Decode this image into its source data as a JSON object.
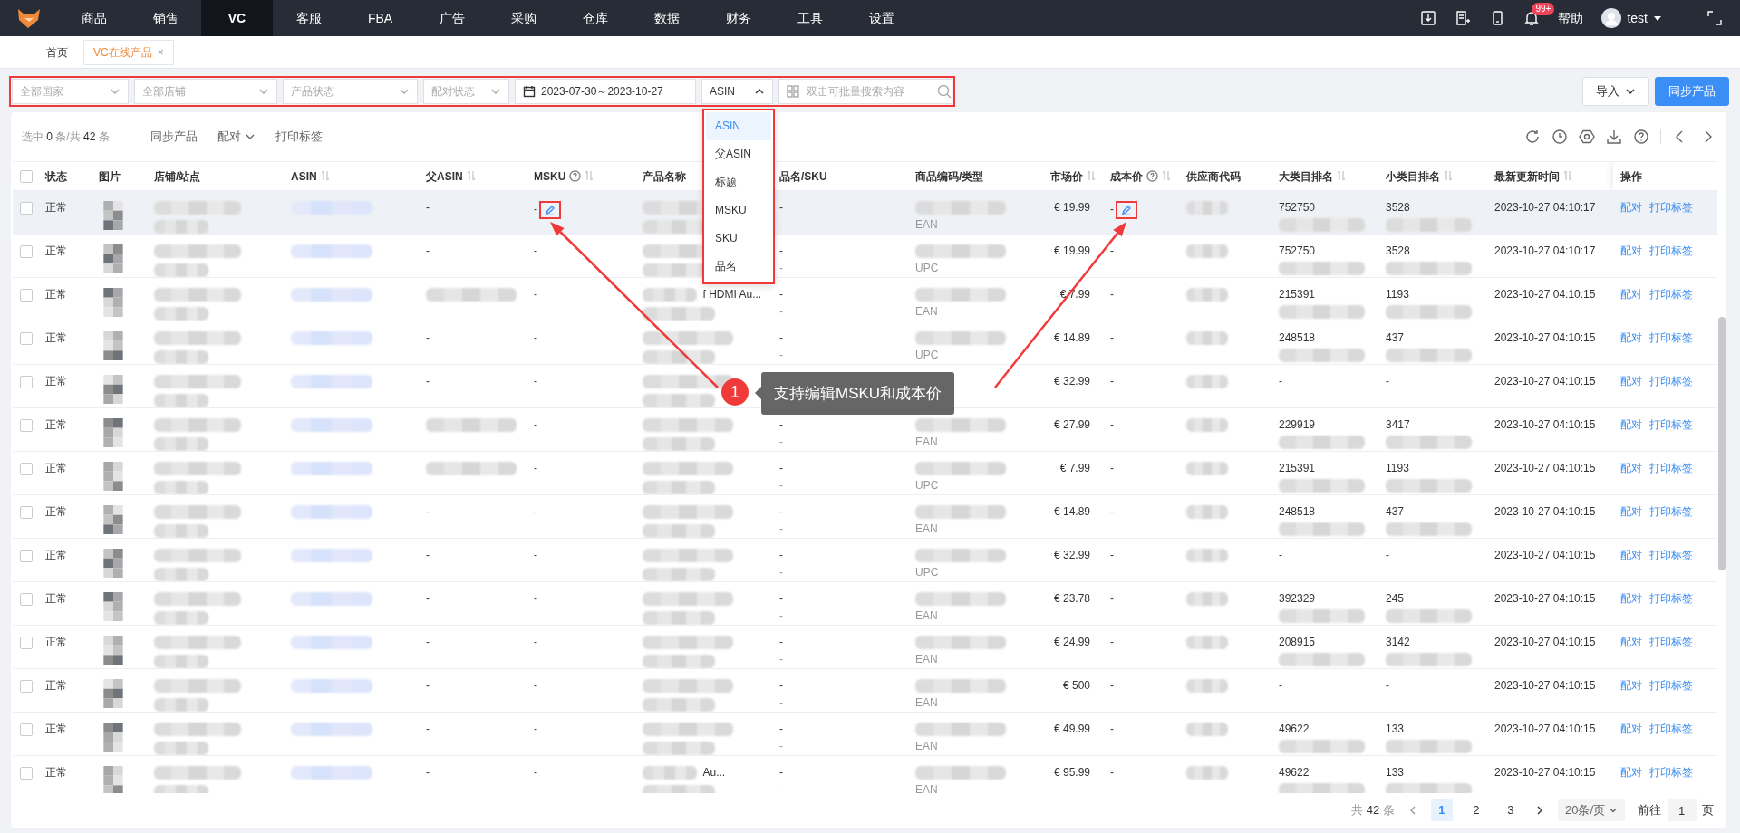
{
  "nav": {
    "items": [
      {
        "label": "商品",
        "selected": false
      },
      {
        "label": "销售",
        "selected": false
      },
      {
        "label": "VC",
        "selected": true
      },
      {
        "label": "客服",
        "selected": false
      },
      {
        "label": "FBA",
        "selected": false
      },
      {
        "label": "广告",
        "selected": false
      },
      {
        "label": "采购",
        "selected": false
      },
      {
        "label": "仓库",
        "selected": false
      },
      {
        "label": "数据",
        "selected": false
      },
      {
        "label": "财务",
        "selected": false
      },
      {
        "label": "工具",
        "selected": false
      },
      {
        "label": "设置",
        "selected": false
      }
    ],
    "notification_badge": "99+",
    "help": "帮助",
    "user": "test"
  },
  "tabs": [
    {
      "label": "首页",
      "selected": false
    },
    {
      "label": "VC在线产品",
      "selected": true,
      "close": "×"
    }
  ],
  "filters": [
    {
      "kind": "select",
      "placeholder": "全部国家"
    },
    {
      "kind": "select",
      "placeholder": "全部店铺"
    },
    {
      "kind": "select",
      "placeholder": "产品状态"
    },
    {
      "kind": "select",
      "placeholder": "配对状态"
    },
    {
      "kind": "date",
      "value": "2023-07-30～2023-10-27"
    },
    {
      "kind": "type_select",
      "value": "ASIN",
      "expanded": true,
      "options": [
        {
          "label": "ASIN",
          "selected": true
        },
        {
          "label": "父ASIN",
          "selected": false
        },
        {
          "label": "标题",
          "selected": false
        },
        {
          "label": "MSKU",
          "selected": false
        },
        {
          "label": "SKU",
          "selected": false
        },
        {
          "label": "品名",
          "selected": false
        }
      ]
    },
    {
      "kind": "search",
      "placeholder": "双击可批量搜索内容"
    }
  ],
  "header_buttons": [
    {
      "label": "导入",
      "kind": "dropdown"
    },
    {
      "label": "同步产品",
      "kind": "primary"
    }
  ],
  "toolbar": {
    "selection": "选中 **0** 条/共 **42** 条",
    "actions": [
      {
        "label": "同步产品",
        "dropdown": false
      },
      {
        "label": "配对",
        "dropdown": true
      },
      {
        "label": "打印标签",
        "dropdown": false
      }
    ]
  },
  "table": {
    "select_all_checked": false,
    "columns": [
      {
        "label": "状态",
        "help": false,
        "sortable": false
      },
      {
        "label": "图片",
        "help": false,
        "sortable": false
      },
      {
        "label": "店铺/站点",
        "help": false,
        "sortable": false
      },
      {
        "label": "ASIN",
        "help": false,
        "sortable": true
      },
      {
        "label": "父ASIN",
        "help": false,
        "sortable": true
      },
      {
        "label": "MSKU",
        "help": true,
        "sortable": true
      },
      {
        "label": "产品名称",
        "help": false,
        "sortable": false
      },
      {
        "label": "品名/SKU",
        "help": false,
        "sortable": false
      },
      {
        "label": "商品编码/类型",
        "help": false,
        "sortable": false
      },
      {
        "label": "市场价",
        "help": false,
        "sortable": true
      },
      {
        "label": "成本价",
        "help": true,
        "sortable": true
      },
      {
        "label": "供应商代码",
        "help": false,
        "sortable": false
      },
      {
        "label": "大类目排名",
        "help": false,
        "sortable": true
      },
      {
        "label": "小类目排名",
        "help": false,
        "sortable": true
      },
      {
        "label": "最新更新时间",
        "help": false,
        "sortable": true
      },
      {
        "label": "操作",
        "help": false,
        "sortable": false
      }
    ],
    "rows": [
      {
        "checked": false,
        "highlighted": true,
        "status": "正常",
        "parent_asin": "-",
        "msku": "-",
        "msku_edit": true,
        "name_sku": [
          "-",
          "-"
        ],
        "code_type": "EAN",
        "market_price": "€ 19.99",
        "cost": "-",
        "cost_edit": true,
        "major_rank": "752750",
        "minor_rank": "3528",
        "updated": "2023-10-27 04:10:17",
        "actions": [
          "配对",
          "打印标签"
        ]
      },
      {
        "checked": false,
        "highlighted": false,
        "status": "正常",
        "parent_asin": "-",
        "msku": "-",
        "msku_edit": false,
        "name_sku": [
          "-",
          "-"
        ],
        "code_type": "UPC",
        "market_price": "€ 19.99",
        "cost": "-",
        "cost_edit": false,
        "major_rank": "752750",
        "minor_rank": "3528",
        "updated": "2023-10-27 04:10:17",
        "actions": [
          "配对",
          "打印标签"
        ]
      },
      {
        "checked": false,
        "highlighted": false,
        "status": "正常",
        "msku": "-",
        "msku_edit": false,
        "product_text": "f HDMI Au...",
        "name_sku": [
          "-",
          "-"
        ],
        "code_type": "EAN",
        "market_price": "€ 7.99",
        "cost": "-",
        "cost_edit": false,
        "major_rank": "215391",
        "minor_rank": "1193",
        "updated": "2023-10-27 04:10:15",
        "actions": [
          "配对",
          "打印标签"
        ]
      },
      {
        "checked": false,
        "highlighted": false,
        "status": "正常",
        "parent_asin": "-",
        "msku": "-",
        "msku_edit": false,
        "name_sku": [
          "-",
          "-"
        ],
        "code_type": "UPC",
        "market_price": "€ 14.89",
        "cost": "-",
        "cost_edit": false,
        "major_rank": "248518",
        "minor_rank": "437",
        "updated": "2023-10-27 04:10:15",
        "actions": [
          "配对",
          "打印标签"
        ]
      },
      {
        "checked": false,
        "highlighted": false,
        "status": "正常",
        "parent_asin": "-",
        "msku": "-",
        "msku_edit": false,
        "market_price": "€ 32.99",
        "cost": "-",
        "cost_edit": false,
        "major_rank": "-",
        "minor_rank": "-",
        "updated": "2023-10-27 04:10:15",
        "actions": [
          "配对",
          "打印标签"
        ]
      },
      {
        "checked": false,
        "highlighted": false,
        "status": "正常",
        "msku": "-",
        "msku_edit": false,
        "name_sku": [
          "-",
          "-"
        ],
        "code_type": "EAN",
        "market_price": "€ 27.99",
        "cost": "-",
        "cost_edit": false,
        "major_rank": "229919",
        "minor_rank": "3417",
        "updated": "2023-10-27 04:10:15",
        "actions": [
          "配对",
          "打印标签"
        ]
      },
      {
        "checked": false,
        "highlighted": false,
        "status": "正常",
        "msku": "-",
        "msku_edit": false,
        "name_sku": [
          "-",
          "-"
        ],
        "code_type": "UPC",
        "market_price": "€ 7.99",
        "cost": "-",
        "cost_edit": false,
        "major_rank": "215391",
        "minor_rank": "1193",
        "updated": "2023-10-27 04:10:15",
        "actions": [
          "配对",
          "打印标签"
        ]
      },
      {
        "checked": false,
        "highlighted": false,
        "status": "正常",
        "parent_asin": "-",
        "msku": "-",
        "msku_edit": false,
        "name_sku": [
          "-",
          "-"
        ],
        "code_type": "EAN",
        "market_price": "€ 14.89",
        "cost": "-",
        "cost_edit": false,
        "major_rank": "248518",
        "minor_rank": "437",
        "updated": "2023-10-27 04:10:15",
        "actions": [
          "配对",
          "打印标签"
        ]
      },
      {
        "checked": false,
        "highlighted": false,
        "status": "正常",
        "parent_asin": "-",
        "msku": "-",
        "msku_edit": false,
        "name_sku": [
          "-",
          "-"
        ],
        "code_type": "UPC",
        "market_price": "€ 32.99",
        "cost": "-",
        "cost_edit": false,
        "major_rank": "-",
        "minor_rank": "-",
        "updated": "2023-10-27 04:10:15",
        "actions": [
          "配对",
          "打印标签"
        ]
      },
      {
        "checked": false,
        "highlighted": false,
        "status": "正常",
        "parent_asin": "-",
        "msku": "-",
        "msku_edit": false,
        "name_sku": [
          "-",
          "-"
        ],
        "code_type": "EAN",
        "market_price": "€ 23.78",
        "cost": "-",
        "cost_edit": false,
        "major_rank": "392329",
        "minor_rank": "245",
        "updated": "2023-10-27 04:10:15",
        "actions": [
          "配对",
          "打印标签"
        ]
      },
      {
        "checked": false,
        "highlighted": false,
        "status": "正常",
        "parent_asin": "-",
        "msku": "-",
        "msku_edit": false,
        "name_sku": [
          "-",
          "-"
        ],
        "code_type": "EAN",
        "market_price": "€ 24.99",
        "cost": "-",
        "cost_edit": false,
        "major_rank": "208915",
        "minor_rank": "3142",
        "updated": "2023-10-27 04:10:15",
        "actions": [
          "配对",
          "打印标签"
        ]
      },
      {
        "checked": false,
        "highlighted": false,
        "status": "正常",
        "parent_asin": "-",
        "msku": "-",
        "msku_edit": false,
        "name_sku": [
          "-",
          "-"
        ],
        "code_type": "EAN",
        "market_price": "€ 500",
        "cost": "-",
        "cost_edit": false,
        "major_rank": "-",
        "minor_rank": "-",
        "updated": "2023-10-27 04:10:15",
        "actions": [
          "配对",
          "打印标签"
        ]
      },
      {
        "checked": false,
        "highlighted": false,
        "status": "正常",
        "parent_asin": "-",
        "msku": "-",
        "msku_edit": false,
        "name_sku": [
          "-",
          "-"
        ],
        "code_type": "EAN",
        "market_price": "€ 49.99",
        "cost": "-",
        "cost_edit": false,
        "major_rank": "49622",
        "minor_rank": "133",
        "updated": "2023-10-27 04:10:15",
        "actions": [
          "配对",
          "打印标签"
        ]
      },
      {
        "checked": false,
        "highlighted": false,
        "status": "正常",
        "parent_asin": "-",
        "msku": "-",
        "msku_edit": false,
        "product_text": "Au...",
        "name_sku": [
          "-",
          "-"
        ],
        "code_type": "EAN",
        "market_price": "€ 95.99",
        "cost": "-",
        "cost_edit": false,
        "major_rank": "49622",
        "minor_rank": "133",
        "updated": "2023-10-27 04:10:15",
        "actions": [
          "配对",
          "打印标签"
        ]
      }
    ]
  },
  "pagination": {
    "total_prefix": "共",
    "total": "42",
    "total_suffix": "条",
    "pages": [
      {
        "label": "1",
        "selected": true
      },
      {
        "label": "2",
        "selected": false
      },
      {
        "label": "3",
        "selected": false
      }
    ],
    "page_size": "20条/页",
    "goto_label": "前往",
    "goto_value": "1",
    "goto_suffix": "页"
  },
  "annotation": {
    "number": "1",
    "text": "支持编辑MSKU和成本价"
  }
}
